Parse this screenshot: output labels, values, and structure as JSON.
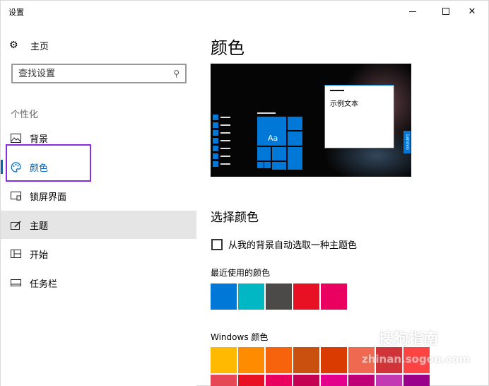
{
  "window": {
    "title": "设置",
    "controls": {
      "minimize": "",
      "maximize": "",
      "close": "✕"
    }
  },
  "sidebar": {
    "home_label": "主页",
    "home_icon": "gear-icon",
    "search_placeholder": "查找设置",
    "section_label": "个性化",
    "items": [
      {
        "label": "背景",
        "icon": "picture-icon"
      },
      {
        "label": "颜色",
        "icon": "palette-icon",
        "selected": true
      },
      {
        "label": "锁屏界面",
        "icon": "lockscreen-icon"
      },
      {
        "label": "主题",
        "icon": "theme-brush-icon",
        "hovered": true
      },
      {
        "label": "开始",
        "icon": "start-grid-icon"
      },
      {
        "label": "任务栏",
        "icon": "taskbar-icon"
      }
    ]
  },
  "main": {
    "title": "颜色",
    "preview": {
      "tile_text": "Aa",
      "sample_text": "示例文本",
      "side_tab": "Lenovo"
    },
    "choose_color_title": "选择颜色",
    "auto_pick_label": "从我的背景自动选取一种主题色",
    "auto_pick_checked": false,
    "recent_label": "最近使用的颜色",
    "recent_colors": [
      "#0078d7",
      "#00b7c3",
      "#4c4a48",
      "#e81123",
      "#ea005e"
    ],
    "windows_colors_label": "Windows 颜色",
    "windows_colors": [
      [
        "#ffb900",
        "#ff8c00",
        "#f7630c",
        "#ca5010",
        "#da3b01",
        "#ef6950",
        "#d13438",
        "#ff4343"
      ],
      [
        "#e74856",
        "#e81123",
        "#ea005e",
        "#c30052",
        "#e3008c",
        "#bf0077",
        "#c239b3",
        "#9a0089"
      ]
    ]
  },
  "watermark": {
    "logo": "S",
    "brand": "搜狗指南",
    "url": "zhinan.sogou.com"
  },
  "colors": {
    "accent": "#0067c0",
    "annotation_box": "#8a2be2",
    "hover_bg": "#e5e5e5"
  }
}
